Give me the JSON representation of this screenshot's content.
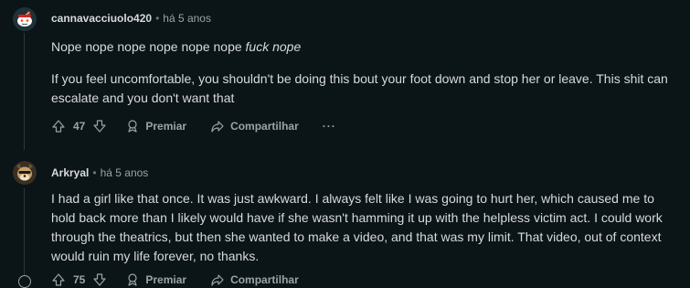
{
  "comments": [
    {
      "author": "cannavacciuolo420",
      "time": "há 5 anos",
      "line1_plain": "Nope nope nope nope nope nope ",
      "line1_italic": "fuck nope",
      "paragraph2": "If you feel uncomfortable, you shouldn't be doing this bout your foot down and stop her or leave. This shit can escalate and you don't want that",
      "votes": "47",
      "award_label": "Premiar",
      "share_label": "Compartilhar",
      "more_label": "···"
    },
    {
      "author": "Arkryal",
      "time": "há 5 anos",
      "paragraph1": "I had a girl like that once. It was just awkward. I always felt like I was going to hurt her, which caused me to hold back more than I likely would have if she wasn't hamming it up with the helpless victim act. I could work through the theatrics, but then she wanted to make a video, and that was my limit. That video, out of context would ruin my life forever, no thanks.",
      "votes": "75",
      "award_label": "Premiar",
      "share_label": "Compartilhar"
    }
  ],
  "meta_separator": "•",
  "colors": {
    "background": "#0b1416",
    "text": "#d7dadc",
    "muted": "#9aa3a6"
  },
  "icons": [
    "snoo-avatar-icon",
    "upvote-icon",
    "downvote-icon",
    "award-icon",
    "share-icon",
    "more-icon",
    "dog-avatar-icon"
  ]
}
